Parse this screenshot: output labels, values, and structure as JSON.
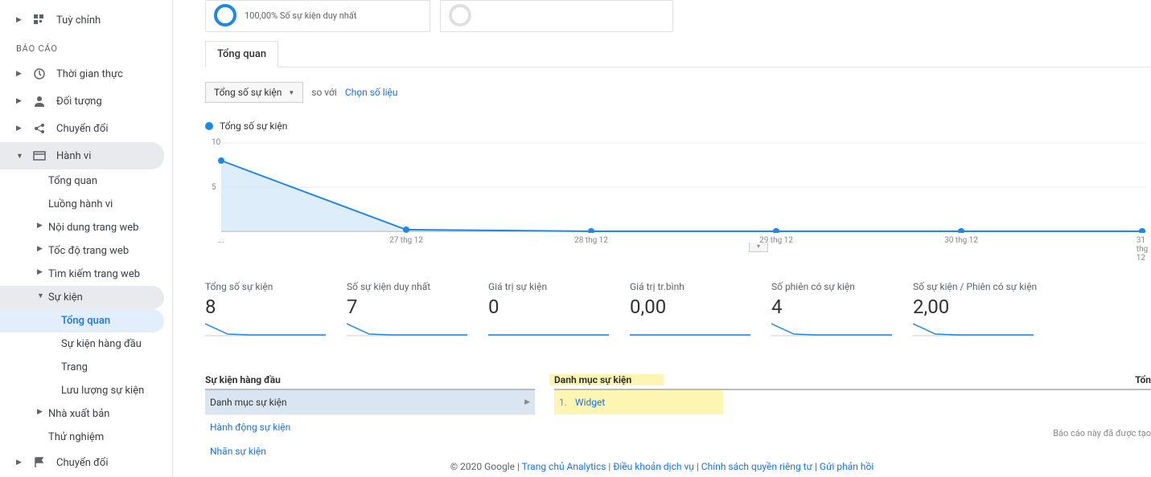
{
  "sidebar": {
    "items": [
      {
        "label": "Tuỳ chỉnh"
      },
      {
        "label": "Thời gian thực"
      },
      {
        "label": "Đối tượng"
      },
      {
        "label": "Chuyển đổi"
      },
      {
        "label": "Hành vi"
      },
      {
        "label": "Chuyển đổi"
      }
    ],
    "section_label": "BÁO CÁO",
    "behavior_children": [
      {
        "label": "Tổng quan"
      },
      {
        "label": "Luồng hành vi"
      },
      {
        "label": "Nội dung trang web"
      },
      {
        "label": "Tốc độ trang web"
      },
      {
        "label": "Tìm kiếm trang web"
      },
      {
        "label": "Sự kiện"
      },
      {
        "label": "Nhà xuất bản"
      },
      {
        "label": "Thử nghiệm"
      }
    ],
    "event_children": [
      {
        "label": "Tổng quan"
      },
      {
        "label": "Sự kiện hàng đầu"
      },
      {
        "label": "Trang"
      },
      {
        "label": "Lưu lượng sự kiện"
      }
    ]
  },
  "summary": {
    "card1": "100,00% Số sự kiện duy nhất"
  },
  "tabs": {
    "overview": "Tổng quan"
  },
  "controls": {
    "dropdown_label": "Tổng số sự kiện",
    "compare": "so với",
    "choose_metric": "Chọn số liệu"
  },
  "legend": {
    "series1": "Tổng số sự kiện"
  },
  "chart_data": {
    "type": "line",
    "x": [
      "...",
      "27 thg 12",
      "28 thg 12",
      "29 thg 12",
      "30 thg 12",
      "31 thg 12"
    ],
    "y": [
      8,
      0,
      0,
      0,
      0,
      0
    ],
    "yticks": [
      5,
      10
    ],
    "ylim": [
      0,
      10
    ]
  },
  "metrics": [
    {
      "label": "Tổng số sự kiện",
      "value": "8"
    },
    {
      "label": "Số sự kiện duy nhất",
      "value": "7"
    },
    {
      "label": "Giá trị sự kiện",
      "value": "0"
    },
    {
      "label": "Giá trị tr.bình",
      "value": "0,00"
    },
    {
      "label": "Số phiên có sự kiện",
      "value": "4"
    },
    {
      "label": "Số sự kiện / Phiên có sự kiện",
      "value": "2,00"
    }
  ],
  "top_events": {
    "header": "Sự kiện hàng đầu",
    "items": [
      {
        "label": "Danh mục sự kiện"
      },
      {
        "label": "Hành động sự kiện"
      },
      {
        "label": "Nhãn sự kiện"
      }
    ]
  },
  "category": {
    "header": "Danh mục sự kiện",
    "total_label": "Tổn",
    "rows": [
      {
        "idx": "1.",
        "label": "Widget"
      }
    ]
  },
  "footer_note": "Báo cáo này đã được tạo",
  "footer": {
    "copyright": "© 2020 Google",
    "links": [
      "Trang chủ Analytics",
      "Điều khoản dịch vụ",
      "Chính sách quyền riêng tư",
      "Gửi phản hồi"
    ]
  }
}
